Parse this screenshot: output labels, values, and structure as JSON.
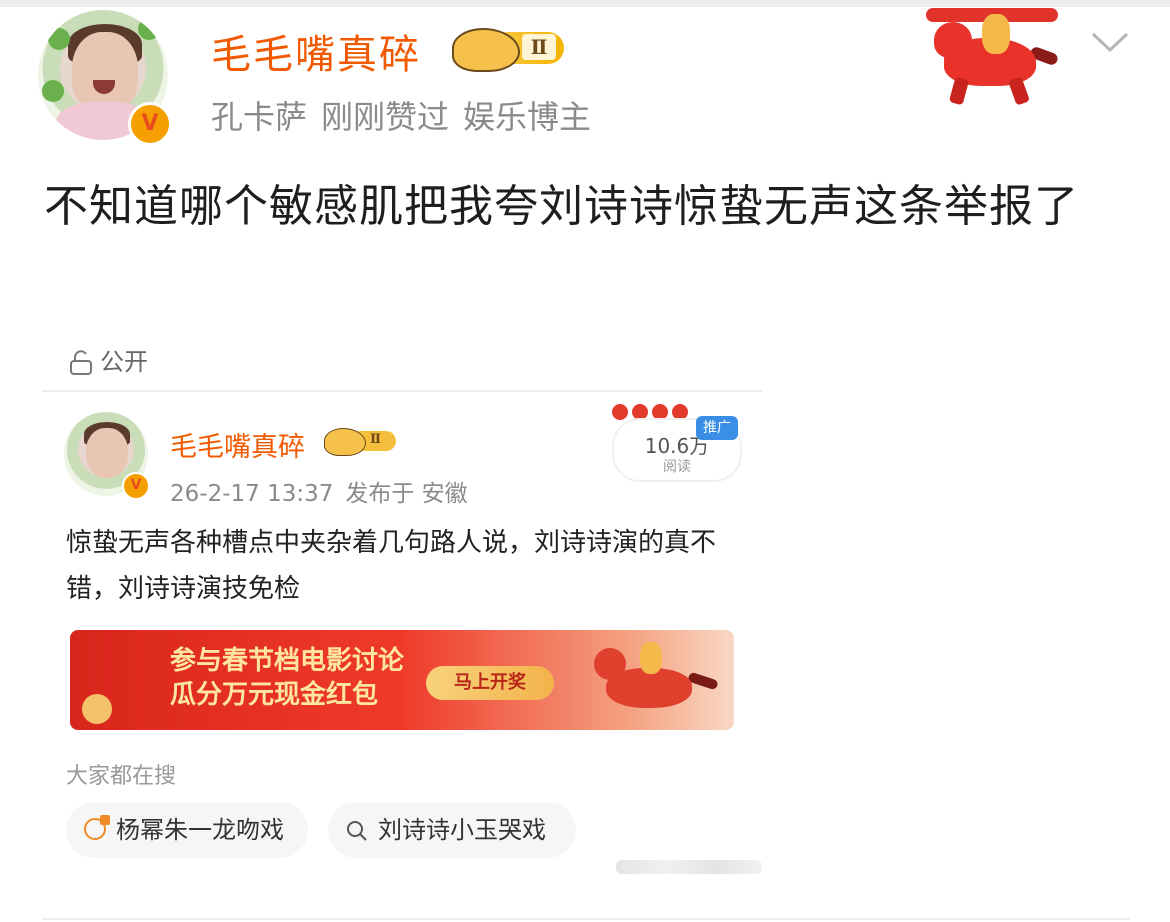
{
  "header": {
    "username": "毛毛嘴真碎",
    "level": "Ⅱ",
    "meta": [
      "孔卡萨",
      "刚刚赞过",
      "娱乐博主"
    ],
    "verified": "V"
  },
  "post": {
    "text": "不知道哪个敏感肌把我夸刘诗诗惊蛰无声这条举报了"
  },
  "embed": {
    "visibility": "公开",
    "username": "毛毛嘴真碎",
    "level": "Ⅱ",
    "verified": "V",
    "meta": [
      "26-2-17 13:37",
      "发布于 安徽"
    ],
    "read_count": "10.6万",
    "read_label": "阅读",
    "ad_tag": "推广",
    "text": "惊蛰无声各种槽点中夹杂着几句路人说，刘诗诗演的真不错，刘诗诗演技免检",
    "banner": {
      "line1": "参与春节档电影讨论",
      "line2": "瓜分万元现金红包",
      "button": "马上开奖"
    },
    "search": {
      "title": "大家都在搜",
      "chips": [
        "杨幂朱一龙吻戏",
        "刘诗诗小玉哭戏"
      ]
    }
  },
  "colors": {
    "username": "#f15a00",
    "meta": "#8a8a8a",
    "banner": "#e0302a"
  },
  "icons": [
    "chevron-down-icon",
    "lock-icon",
    "search-icon",
    "hot-search-icon"
  ]
}
